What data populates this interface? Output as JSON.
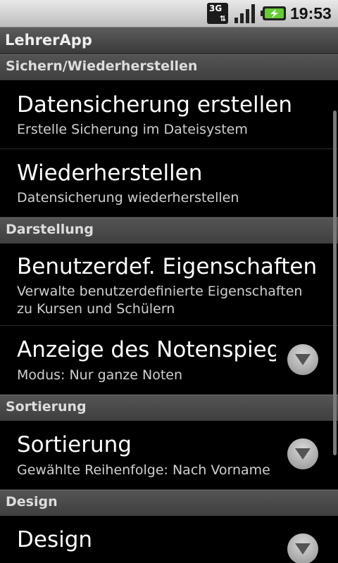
{
  "status_bar": {
    "network": "3G",
    "time": "19:53"
  },
  "app_title": "LehrerApp",
  "sections": [
    {
      "header": "Sichern/Wiederherstellen",
      "items": [
        {
          "title": "Datensicherung erstellen",
          "summary": "Erstelle Sicherung im Dateisystem"
        },
        {
          "title": "Wiederherstellen",
          "summary": "Datensicherung wiederherstellen"
        }
      ]
    },
    {
      "header": "Darstellung",
      "items": [
        {
          "title": "Benutzerdef. Eigenschaften",
          "summary": "Verwalte benutzerdefinierte Eigenschaften zu Kursen und Schülern"
        },
        {
          "title": "Anzeige des Notenspiegels",
          "summary": "Modus: Nur ganze Noten"
        }
      ]
    },
    {
      "header": "Sortierung",
      "items": [
        {
          "title": "Sortierung",
          "summary": "Gewählte Reihenfolge: Nach Vorname"
        }
      ]
    },
    {
      "header": "Design",
      "items": [
        {
          "title": "Design",
          "summary": ""
        }
      ]
    }
  ]
}
